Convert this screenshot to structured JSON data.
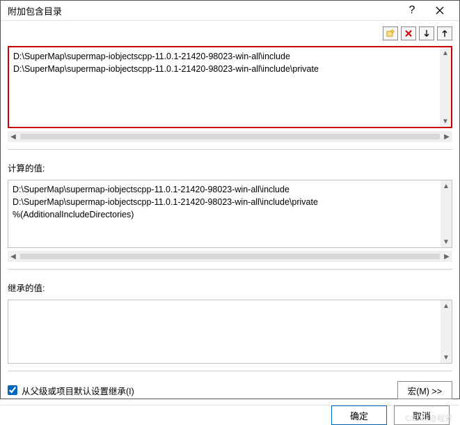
{
  "window": {
    "title": "附加包含目录",
    "help": "?",
    "close": "✕"
  },
  "toolbar": {
    "new_line": "new-line-icon",
    "delete": "✕",
    "move_down": "↓",
    "move_up": "↑"
  },
  "input_paths": [
    "D:\\SuperMap\\supermap-iobjectscpp-11.0.1-21420-98023-win-all\\include",
    "D:\\SuperMap\\supermap-iobjectscpp-11.0.1-21420-98023-win-all\\include\\private"
  ],
  "computed": {
    "label": "计算的值:",
    "values": [
      "D:\\SuperMap\\supermap-iobjectscpp-11.0.1-21420-98023-win-all\\include",
      "D:\\SuperMap\\supermap-iobjectscpp-11.0.1-21420-98023-win-all\\include\\private",
      "%(AdditionalIncludeDirectories)"
    ]
  },
  "inherited": {
    "label": "继承的值:",
    "values": []
  },
  "inherit_checkbox": {
    "label": "从父级或项目默认设置继承(I)",
    "checked": true
  },
  "macro_button": "宏(M) >>",
  "footer": {
    "ok": "确定",
    "cancel": "取消"
  },
  "watermark": "CSDN @程贤"
}
